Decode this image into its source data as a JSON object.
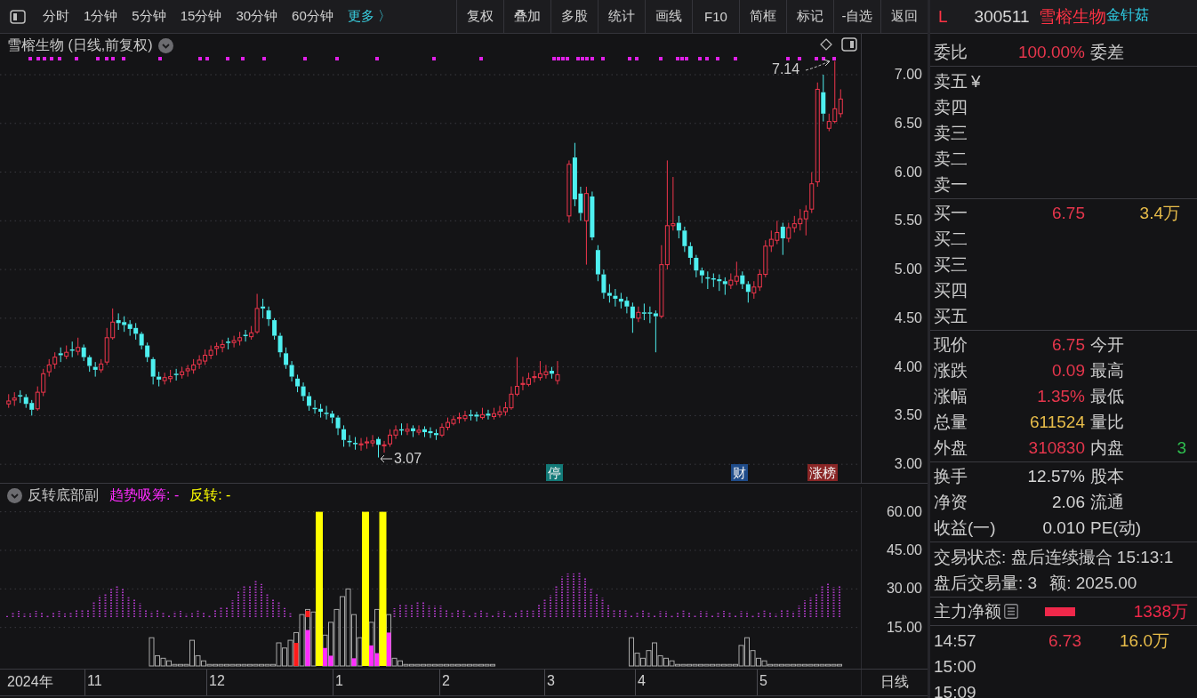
{
  "toolbar": {
    "periods": [
      "分时",
      "1分钟",
      "5分钟",
      "15分钟",
      "30分钟",
      "60分钟"
    ],
    "more": "更多 〉",
    "buttons": [
      "复权",
      "叠加",
      "多股",
      "统计",
      "画线",
      "F10",
      "简框",
      "标记",
      "-自选",
      "返回"
    ]
  },
  "quote_header": {
    "market": "L",
    "code": "300511",
    "name": "雪榕生物",
    "concept": "金针菇"
  },
  "main_chart": {
    "title": "雪榕生物 (日线,前复权)",
    "high_label": "7.14",
    "low_label": "3.07",
    "event_markers": [
      {
        "label": "停",
        "color": "#137a78"
      },
      {
        "label": "财",
        "color": "#1f4c8a"
      },
      {
        "label": "涨榜",
        "color": "#8a2626"
      }
    ],
    "chart_data": {
      "type": "candlestick",
      "grid": true,
      "ylim": [
        2.81,
        7.42
      ],
      "yticks": [
        {
          "value": 7,
          "label": "7.00"
        },
        {
          "value": 6.5,
          "label": "6.50"
        },
        {
          "value": 6,
          "label": "6.00"
        },
        {
          "value": 5.5,
          "label": "5.50"
        },
        {
          "value": 5,
          "label": "5.00"
        },
        {
          "value": 4.5,
          "label": "4.50"
        },
        {
          "value": 4,
          "label": "4.00"
        },
        {
          "value": 3.5,
          "label": "3.50"
        },
        {
          "value": 3,
          "label": "3.00"
        }
      ],
      "categories": [
        null,
        null,
        null,
        null,
        null,
        null,
        null,
        null,
        null,
        null,
        null,
        null,
        null,
        null,
        null,
        null,
        null,
        null,
        null,
        null,
        null,
        null,
        null,
        null,
        null,
        null,
        null,
        null,
        null,
        null,
        null,
        null,
        null,
        null,
        null,
        null,
        null,
        null,
        null,
        null,
        null,
        null,
        null,
        null,
        null,
        null,
        null,
        null,
        null,
        null,
        null,
        null,
        null,
        null,
        null,
        null,
        null,
        null,
        null,
        null,
        null,
        null,
        null,
        null,
        null,
        null,
        null,
        null,
        null,
        null,
        null,
        null,
        null,
        null,
        null,
        null,
        null,
        null,
        null,
        null,
        null,
        null,
        null,
        null,
        null,
        null,
        null,
        null,
        null,
        null,
        null,
        null,
        null,
        null,
        null,
        null,
        null,
        null,
        null,
        null,
        null,
        null,
        null,
        null,
        null,
        null,
        null,
        null,
        null,
        null,
        null,
        null,
        null,
        null,
        null,
        null,
        null,
        null,
        null,
        null,
        null,
        null,
        null,
        null,
        null,
        null,
        null,
        null,
        null,
        null,
        null,
        null,
        null,
        null,
        null,
        null,
        null,
        null,
        null,
        null,
        null,
        null,
        null,
        null,
        null,
        null,
        null,
        null,
        null
      ],
      "ohlc": [
        null,
        [
          3.62,
          3.72,
          3.58,
          3.65
        ],
        [
          3.66,
          3.74,
          3.6,
          3.68
        ],
        [
          3.71,
          3.76,
          3.63,
          3.7
        ],
        [
          3.69,
          3.72,
          3.58,
          3.62
        ],
        [
          3.63,
          3.66,
          3.5,
          3.56
        ],
        [
          3.57,
          3.8,
          3.55,
          3.74
        ],
        [
          3.74,
          3.98,
          3.7,
          3.93
        ],
        [
          3.95,
          4.08,
          3.9,
          4.02
        ],
        [
          4.03,
          4.15,
          3.98,
          4.1
        ],
        [
          4.14,
          4.2,
          4.05,
          4.12
        ],
        [
          4.11,
          4.22,
          4.08,
          4.15
        ],
        [
          4.18,
          4.26,
          4.1,
          4.17
        ],
        [
          4.16,
          4.3,
          4.12,
          4.2
        ],
        [
          4.2,
          4.23,
          4.06,
          4.1
        ],
        [
          4.1,
          4.12,
          3.95,
          4.01
        ],
        [
          4.0,
          4.05,
          3.9,
          3.97
        ],
        [
          3.97,
          4.08,
          3.94,
          4.03
        ],
        [
          4.05,
          4.4,
          4.02,
          4.3
        ],
        [
          4.3,
          4.6,
          4.28,
          4.46
        ],
        [
          4.48,
          4.55,
          4.38,
          4.45
        ],
        [
          4.46,
          4.52,
          4.36,
          4.43
        ],
        [
          4.44,
          4.48,
          4.32,
          4.39
        ],
        [
          4.4,
          4.45,
          4.28,
          4.34
        ],
        [
          4.34,
          4.36,
          4.18,
          4.22
        ],
        [
          4.22,
          4.25,
          4.05,
          4.1
        ],
        [
          4.08,
          4.1,
          3.82,
          3.9
        ],
        [
          3.9,
          3.95,
          3.8,
          3.87
        ],
        [
          3.86,
          3.94,
          3.82,
          3.89
        ],
        [
          3.88,
          3.97,
          3.84,
          3.9
        ],
        [
          3.93,
          3.98,
          3.86,
          3.92
        ],
        [
          3.92,
          4.0,
          3.88,
          3.95
        ],
        [
          3.96,
          4.02,
          3.9,
          3.98
        ],
        [
          3.97,
          4.08,
          3.93,
          4.02
        ],
        [
          4.03,
          4.12,
          3.98,
          4.07
        ],
        [
          4.06,
          4.18,
          4.02,
          4.12
        ],
        [
          4.12,
          4.22,
          4.08,
          4.17
        ],
        [
          4.19,
          4.25,
          4.12,
          4.21
        ],
        [
          4.2,
          4.28,
          4.15,
          4.23
        ],
        [
          4.26,
          4.3,
          4.18,
          4.25
        ],
        [
          4.25,
          4.32,
          4.2,
          4.27
        ],
        [
          4.27,
          4.36,
          4.22,
          4.3
        ],
        [
          4.33,
          4.38,
          4.26,
          4.32
        ],
        [
          4.31,
          4.42,
          4.28,
          4.35
        ],
        [
          4.36,
          4.75,
          4.34,
          4.6
        ],
        [
          4.62,
          4.7,
          4.5,
          4.6
        ],
        [
          4.58,
          4.62,
          4.42,
          4.49
        ],
        [
          4.48,
          4.5,
          4.28,
          4.32
        ],
        [
          4.32,
          4.35,
          4.1,
          4.15
        ],
        [
          4.14,
          4.2,
          3.98,
          4.02
        ],
        [
          4.02,
          4.06,
          3.85,
          3.9
        ],
        [
          3.88,
          3.92,
          3.74,
          3.8
        ],
        [
          3.8,
          3.84,
          3.65,
          3.7
        ],
        [
          3.7,
          3.74,
          3.55,
          3.6
        ],
        [
          3.58,
          3.66,
          3.52,
          3.57
        ],
        [
          3.57,
          3.62,
          3.48,
          3.54
        ],
        [
          3.53,
          3.6,
          3.46,
          3.52
        ],
        [
          3.52,
          3.55,
          3.42,
          3.48
        ],
        [
          3.48,
          3.5,
          3.3,
          3.37
        ],
        [
          3.36,
          3.4,
          3.18,
          3.25
        ],
        [
          3.24,
          3.3,
          3.18,
          3.23
        ],
        [
          3.22,
          3.28,
          3.15,
          3.21
        ],
        [
          3.2,
          3.27,
          3.14,
          3.21
        ],
        [
          3.22,
          3.28,
          3.16,
          3.23
        ],
        [
          3.22,
          3.3,
          3.18,
          3.24
        ],
        [
          3.26,
          3.28,
          3.07,
          3.2
        ],
        [
          3.19,
          3.24,
          3.12,
          3.2
        ],
        [
          3.21,
          3.36,
          3.18,
          3.3
        ],
        [
          3.3,
          3.4,
          3.26,
          3.35
        ],
        [
          3.36,
          3.42,
          3.3,
          3.35
        ],
        [
          3.34,
          3.42,
          3.3,
          3.36
        ],
        [
          3.37,
          3.4,
          3.28,
          3.34
        ],
        [
          3.33,
          3.4,
          3.3,
          3.35
        ],
        [
          3.36,
          3.39,
          3.28,
          3.33
        ],
        [
          3.34,
          3.38,
          3.27,
          3.32
        ],
        [
          3.32,
          3.36,
          3.25,
          3.3
        ],
        [
          3.3,
          3.42,
          3.28,
          3.38
        ],
        [
          3.38,
          3.48,
          3.35,
          3.43
        ],
        [
          3.42,
          3.5,
          3.4,
          3.46
        ],
        [
          3.47,
          3.53,
          3.42,
          3.48
        ],
        [
          3.47,
          3.55,
          3.44,
          3.5
        ],
        [
          3.51,
          3.56,
          3.45,
          3.5
        ],
        [
          3.51,
          3.54,
          3.44,
          3.49
        ],
        [
          3.48,
          3.58,
          3.46,
          3.51
        ],
        [
          3.52,
          3.56,
          3.46,
          3.5
        ],
        [
          3.49,
          3.58,
          3.46,
          3.52
        ],
        [
          3.51,
          3.6,
          3.48,
          3.54
        ],
        [
          3.54,
          3.64,
          3.5,
          3.58
        ],
        [
          3.58,
          3.8,
          3.56,
          3.72
        ],
        [
          3.72,
          4.1,
          3.7,
          3.8
        ],
        [
          3.82,
          3.9,
          3.76,
          3.83
        ],
        [
          3.82,
          3.94,
          3.8,
          3.88
        ],
        [
          3.89,
          3.96,
          3.84,
          3.9
        ],
        [
          3.89,
          4.06,
          3.86,
          3.93
        ],
        [
          3.92,
          4.02,
          3.88,
          3.95
        ],
        [
          3.96,
          4.0,
          3.88,
          3.93
        ],
        [
          3.86,
          4.06,
          3.82,
          3.92
        ],
        null,
        [
          5.55,
          6.12,
          5.48,
          6.08
        ],
        [
          6.15,
          6.3,
          5.65,
          5.72
        ],
        [
          5.78,
          5.85,
          5.5,
          5.58
        ],
        [
          5.5,
          5.85,
          5.05,
          5.78
        ],
        [
          5.75,
          5.8,
          5.3,
          5.33
        ],
        [
          5.2,
          5.25,
          4.88,
          4.95
        ],
        [
          4.95,
          5.0,
          4.7,
          4.76
        ],
        [
          4.76,
          4.85,
          4.66,
          4.73
        ],
        [
          4.73,
          4.8,
          4.62,
          4.7
        ],
        [
          4.7,
          4.76,
          4.6,
          4.67
        ],
        [
          4.68,
          4.72,
          4.55,
          4.62
        ],
        [
          4.62,
          4.66,
          4.35,
          4.5
        ],
        [
          4.5,
          4.62,
          4.46,
          4.56
        ],
        [
          4.56,
          4.65,
          4.48,
          4.55
        ],
        [
          4.56,
          4.62,
          4.45,
          4.55
        ],
        [
          4.55,
          4.58,
          4.15,
          4.52
        ],
        [
          4.52,
          5.25,
          4.5,
          5.05
        ],
        [
          5.05,
          6.12,
          5.0,
          5.45
        ],
        [
          5.45,
          5.95,
          5.4,
          5.47
        ],
        [
          5.48,
          5.55,
          5.32,
          5.4
        ],
        [
          5.4,
          5.44,
          5.18,
          5.24
        ],
        [
          5.24,
          5.28,
          5.05,
          5.12
        ],
        [
          5.12,
          5.15,
          4.92,
          4.99
        ],
        [
          4.99,
          5.02,
          4.86,
          4.94
        ],
        [
          4.92,
          4.98,
          4.8,
          4.91
        ],
        [
          4.91,
          4.96,
          4.82,
          4.9
        ],
        [
          4.9,
          4.95,
          4.78,
          4.88
        ],
        [
          4.88,
          4.92,
          4.74,
          4.85
        ],
        [
          4.84,
          4.96,
          4.8,
          4.89
        ],
        [
          4.88,
          5.08,
          4.84,
          4.93
        ],
        [
          4.94,
          4.98,
          4.8,
          4.85
        ],
        [
          4.85,
          4.88,
          4.66,
          4.77
        ],
        [
          4.76,
          4.88,
          4.7,
          4.82
        ],
        [
          4.82,
          5.0,
          4.78,
          4.95
        ],
        [
          4.95,
          5.3,
          4.92,
          5.24
        ],
        [
          5.24,
          5.4,
          5.18,
          5.31
        ],
        [
          5.3,
          5.5,
          5.26,
          5.38
        ],
        [
          5.44,
          5.48,
          5.15,
          5.32
        ],
        [
          5.32,
          5.48,
          5.28,
          5.43
        ],
        [
          5.43,
          5.55,
          5.38,
          5.47
        ],
        [
          5.47,
          5.62,
          5.4,
          5.52
        ],
        [
          5.52,
          5.66,
          5.35,
          5.6
        ],
        [
          5.62,
          6.0,
          5.58,
          5.88
        ],
        [
          5.9,
          6.92,
          5.85,
          6.85
        ],
        [
          6.82,
          7.0,
          6.52,
          6.6
        ],
        [
          6.45,
          6.6,
          6.42,
          6.52
        ],
        [
          6.52,
          7.14,
          6.5,
          6.65
        ],
        [
          6.6,
          6.85,
          6.56,
          6.75
        ],
        null,
        null,
        null
      ]
    }
  },
  "indicator": {
    "name": "反转底部副",
    "legend": [
      {
        "label": "趋势吸筹: -",
        "color": "#ff2cff"
      },
      {
        "label": "反转: -",
        "color": "#ffff00"
      }
    ],
    "value_axis": [
      "60.00",
      "45.00",
      "30.00",
      "15.00"
    ]
  },
  "time_axis": {
    "labels": [
      "2024年",
      "11",
      "12",
      "1",
      "2",
      "3",
      "4",
      "5"
    ],
    "period": "日线"
  },
  "quote_panel": {
    "order_ratio": {
      "left": {
        "label": "委比",
        "value": "100.00%",
        "color": "#e5364c"
      },
      "right": {
        "label": "委差"
      }
    },
    "asks": [
      {
        "label": "卖五",
        "currency": "¥"
      },
      {
        "label": "卖四"
      },
      {
        "label": "卖三"
      },
      {
        "label": "卖二"
      },
      {
        "label": "卖一"
      }
    ],
    "bids": [
      {
        "label": "买一",
        "price": "6.75",
        "volume": "3.4万"
      },
      {
        "label": "买二"
      },
      {
        "label": "买三"
      },
      {
        "label": "买四"
      },
      {
        "label": "买五"
      }
    ],
    "stats": [
      {
        "left": {
          "label": "现价",
          "value": "6.75",
          "color": "#e5364c"
        },
        "right": {
          "label": "今开"
        }
      },
      {
        "left": {
          "label": "涨跌",
          "value": "0.09",
          "color": "#e5364c"
        },
        "right": {
          "label": "最高"
        }
      },
      {
        "left": {
          "label": "涨幅",
          "value": "1.35%",
          "color": "#e5364c"
        },
        "right": {
          "label": "最低"
        }
      },
      {
        "left": {
          "label": "总量",
          "value": "611524",
          "color": "#e8bd4a"
        },
        "right": {
          "label": "量比"
        }
      },
      {
        "left": {
          "label": "外盘",
          "value": "310830",
          "color": "#e5364c"
        },
        "right": {
          "label": "内盘",
          "value": "3",
          "color": "#2fbf4f"
        }
      }
    ],
    "fundamentals": [
      {
        "left": {
          "label": "换手",
          "value": "12.57%"
        },
        "right": {
          "label": "股本"
        }
      },
      {
        "left": {
          "label": "净资",
          "value": "2.06"
        },
        "right": {
          "label": "流通"
        }
      },
      {
        "left": {
          "label": "收益(一)",
          "value": "0.010"
        },
        "right": {
          "label": "PE(动)"
        }
      }
    ],
    "session": {
      "status": "交易状态: 盘后连续撮合 15:13:1",
      "volume": "盘后交易量: 3",
      "amount": "额: 2025.00"
    },
    "main_flow": {
      "label": "主力净额",
      "value": "1338万",
      "color": "#f0284a"
    },
    "ticks": [
      {
        "time": "14:57",
        "price": "6.73",
        "volume": "16.0万"
      },
      {
        "time": "15:00"
      },
      {
        "time": "15:09"
      }
    ]
  }
}
